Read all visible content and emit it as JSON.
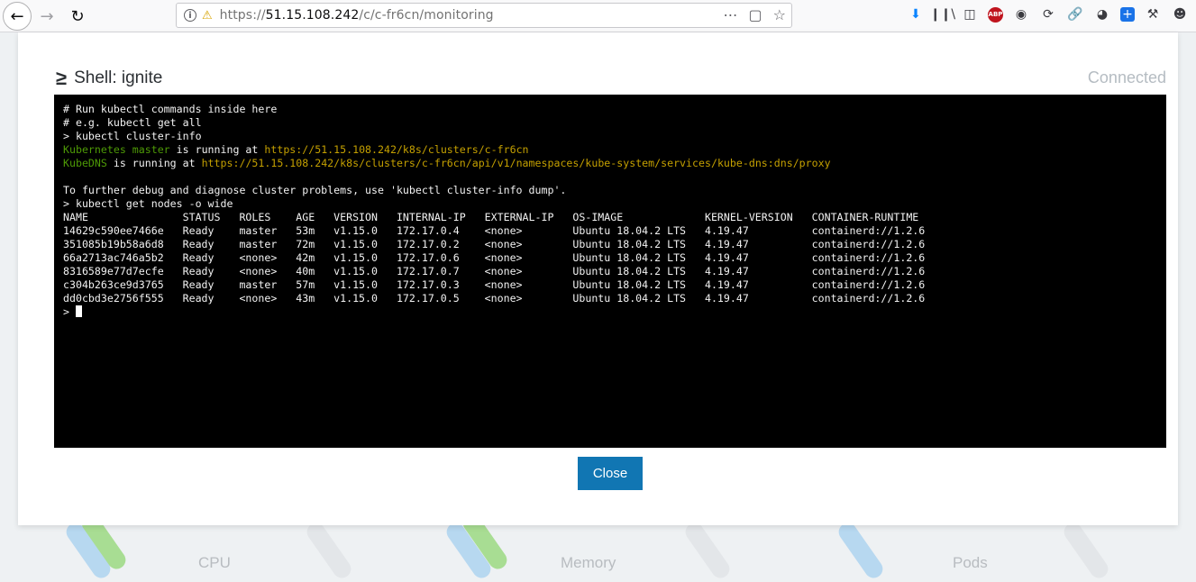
{
  "browser": {
    "url_prefix": "https://",
    "url_host": "51.15.108.242",
    "url_path": "/c/c-fr6cn/monitoring"
  },
  "modal": {
    "title": "Shell: ignite",
    "status": "Connected",
    "close_label": "Close"
  },
  "terminal": {
    "intro": [
      "# Run kubectl commands inside here",
      "# e.g. kubectl get all",
      "> kubectl cluster-info"
    ],
    "k8s_master_label": "Kubernetes master",
    "k8s_master_mid": " is running at ",
    "k8s_master_url": "https://51.15.108.242/k8s/clusters/c-fr6cn",
    "kubedns_label": "KubeDNS",
    "kubedns_mid": " is running at ",
    "kubedns_url": "https://51.15.108.242/k8s/clusters/c-fr6cn/api/v1/namespaces/kube-system/services/kube-dns:dns/proxy",
    "debug_hint": "To further debug and diagnose cluster problems, use 'kubectl cluster-info dump'.",
    "get_nodes_cmd": "> kubectl get nodes -o wide",
    "node_table": {
      "header": "NAME               STATUS   ROLES    AGE   VERSION   INTERNAL-IP   EXTERNAL-IP   OS-IMAGE             KERNEL-VERSION   CONTAINER-RUNTIME",
      "rows": [
        "14629c590ee7466e   Ready    master   53m   v1.15.0   172.17.0.4    <none>        Ubuntu 18.04.2 LTS   4.19.47          containerd://1.2.6",
        "351085b19b58a6d8   Ready    master   72m   v1.15.0   172.17.0.2    <none>        Ubuntu 18.04.2 LTS   4.19.47          containerd://1.2.6",
        "66a2713ac746a5b2   Ready    <none>   42m   v1.15.0   172.17.0.6    <none>        Ubuntu 18.04.2 LTS   4.19.47          containerd://1.2.6",
        "8316589e77d7ecfe   Ready    <none>   40m   v1.15.0   172.17.0.7    <none>        Ubuntu 18.04.2 LTS   4.19.47          containerd://1.2.6",
        "c304b263ce9d3765   Ready    master   57m   v1.15.0   172.17.0.3    <none>        Ubuntu 18.04.2 LTS   4.19.47          containerd://1.2.6",
        "dd0cbd3e2756f555   Ready    <none>   43m   v1.15.0   172.17.0.5    <none>        Ubuntu 18.04.2 LTS   4.19.47          containerd://1.2.6"
      ]
    },
    "prompt": "> "
  },
  "dashboard": {
    "gauges": [
      "CPU",
      "Memory",
      "Pods"
    ]
  }
}
